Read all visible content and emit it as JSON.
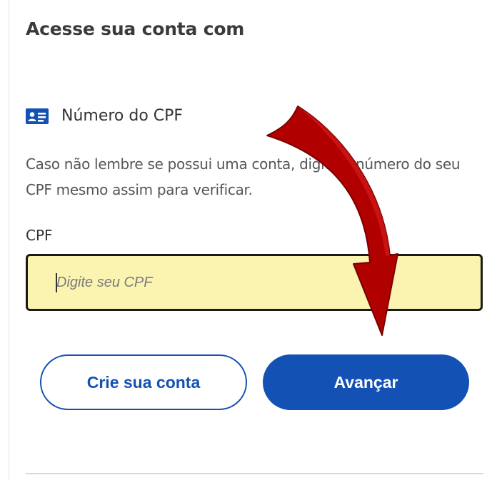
{
  "login": {
    "heading": "Acesse sua conta com",
    "cpf_option": {
      "icon": "id-card-icon",
      "label": "Número do CPF"
    },
    "help_text": "Caso não lembre se possui uma conta, digite o número do seu CPF mesmo assim para verificar.",
    "cpf_field": {
      "label": "CPF",
      "placeholder": "Digite seu CPF",
      "value": ""
    },
    "buttons": {
      "create_account": "Crie sua conta",
      "next": "Avançar"
    }
  },
  "colors": {
    "primary": "#1351b4",
    "input_highlight": "#fbf4b1",
    "annotation_arrow": "#b10000"
  }
}
